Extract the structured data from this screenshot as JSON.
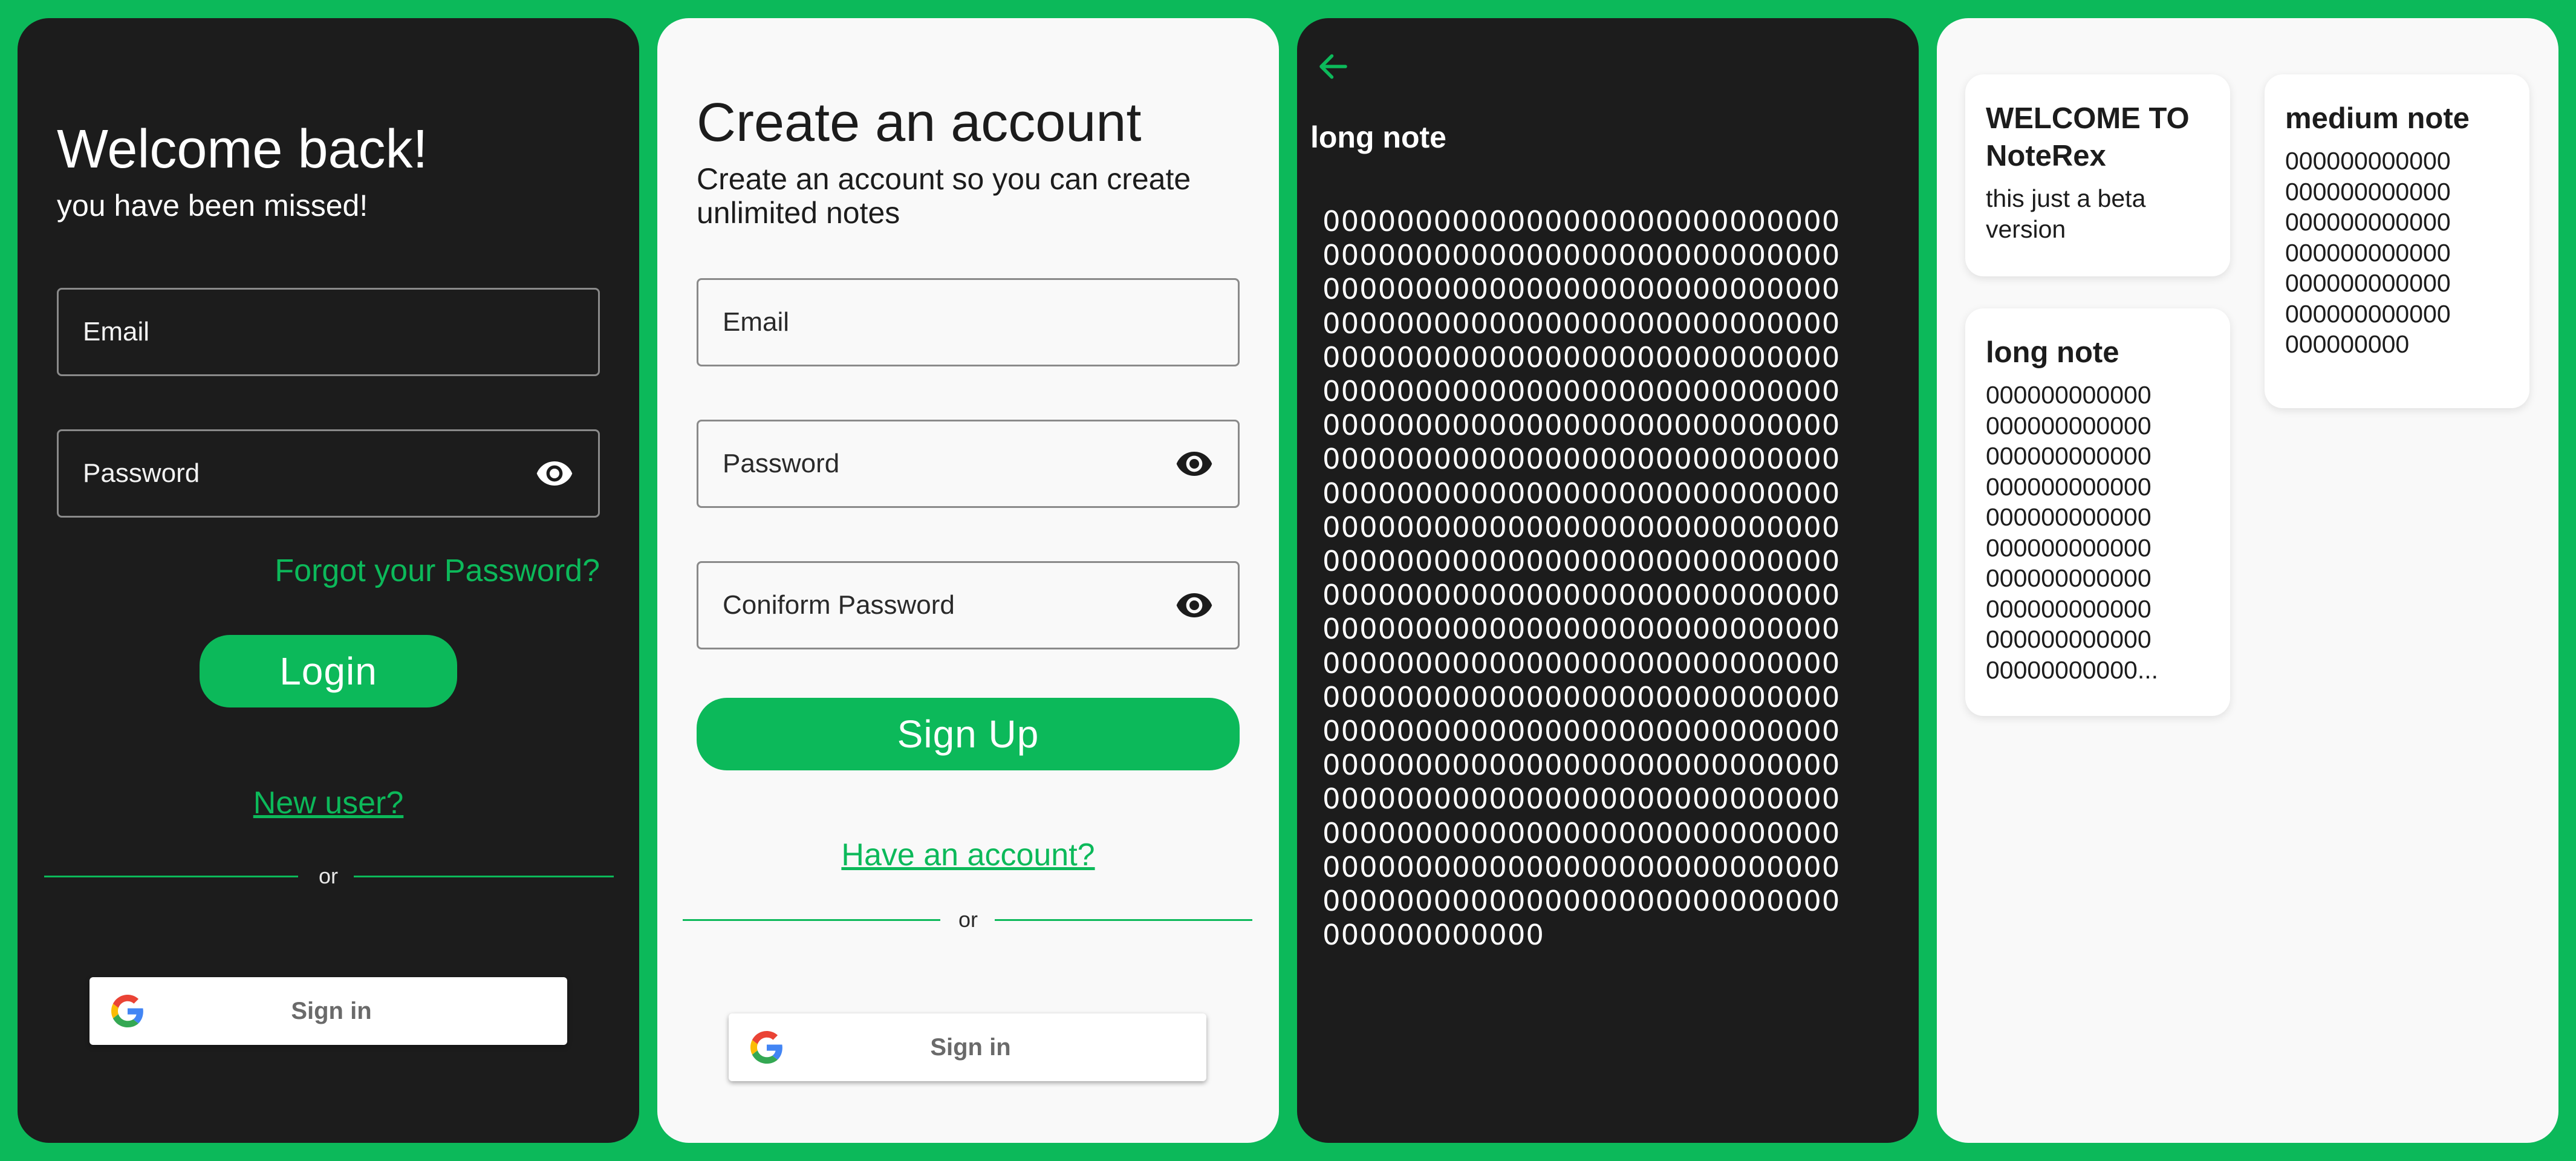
{
  "theme": {
    "accent": "#0cb95a",
    "dark_bg": "#1c1c1c",
    "light_bg": "#f9f9f9"
  },
  "login": {
    "title": "Welcome back!",
    "subtitle": "you have been missed!",
    "email_label": "Email",
    "password_label": "Password",
    "forgot": "Forgot your Password?",
    "login_button": "Login",
    "new_user": "New user?",
    "or": "or",
    "google_sign_in": "Sign in"
  },
  "signup": {
    "title": "Create an account",
    "subtitle": "Create an account so you can create unlimited notes",
    "email_label": "Email",
    "password_label": "Password",
    "confirm_label": "Coniform Password",
    "signup_button": "Sign Up",
    "have_account": "Have an account?",
    "or": "or",
    "google_sign_in": "Sign in"
  },
  "note_detail": {
    "title": "long note",
    "body_lines": [
      "0000000000000000000000000000",
      "0000000000000000000000000000",
      "0000000000000000000000000000",
      "0000000000000000000000000000",
      "0000000000000000000000000000",
      "0000000000000000000000000000",
      "0000000000000000000000000000",
      "0000000000000000000000000000",
      "0000000000000000000000000000",
      "0000000000000000000000000000",
      "0000000000000000000000000000",
      "0000000000000000000000000000",
      "0000000000000000000000000000",
      "0000000000000000000000000000",
      "0000000000000000000000000000",
      "0000000000000000000000000000",
      "0000000000000000000000000000",
      "0000000000000000000000000000",
      "0000000000000000000000000000",
      "0000000000000000000000000000",
      "0000000000000000000000000000",
      "000000000000"
    ]
  },
  "notes_list": {
    "cards": [
      {
        "title": "WELCOME TO NoteRex",
        "body_lines": [
          "this just a beta",
          "version"
        ]
      },
      {
        "title": "long note",
        "body_lines": [
          "000000000000",
          "000000000000",
          "000000000000",
          "000000000000",
          "000000000000",
          "000000000000",
          "000000000000",
          "000000000000",
          "000000000000",
          "00000000000..."
        ]
      },
      {
        "title": "medium note",
        "body_lines": [
          "000000000000",
          "000000000000",
          "000000000000",
          "000000000000",
          "000000000000",
          "000000000000",
          "000000000"
        ]
      }
    ]
  }
}
